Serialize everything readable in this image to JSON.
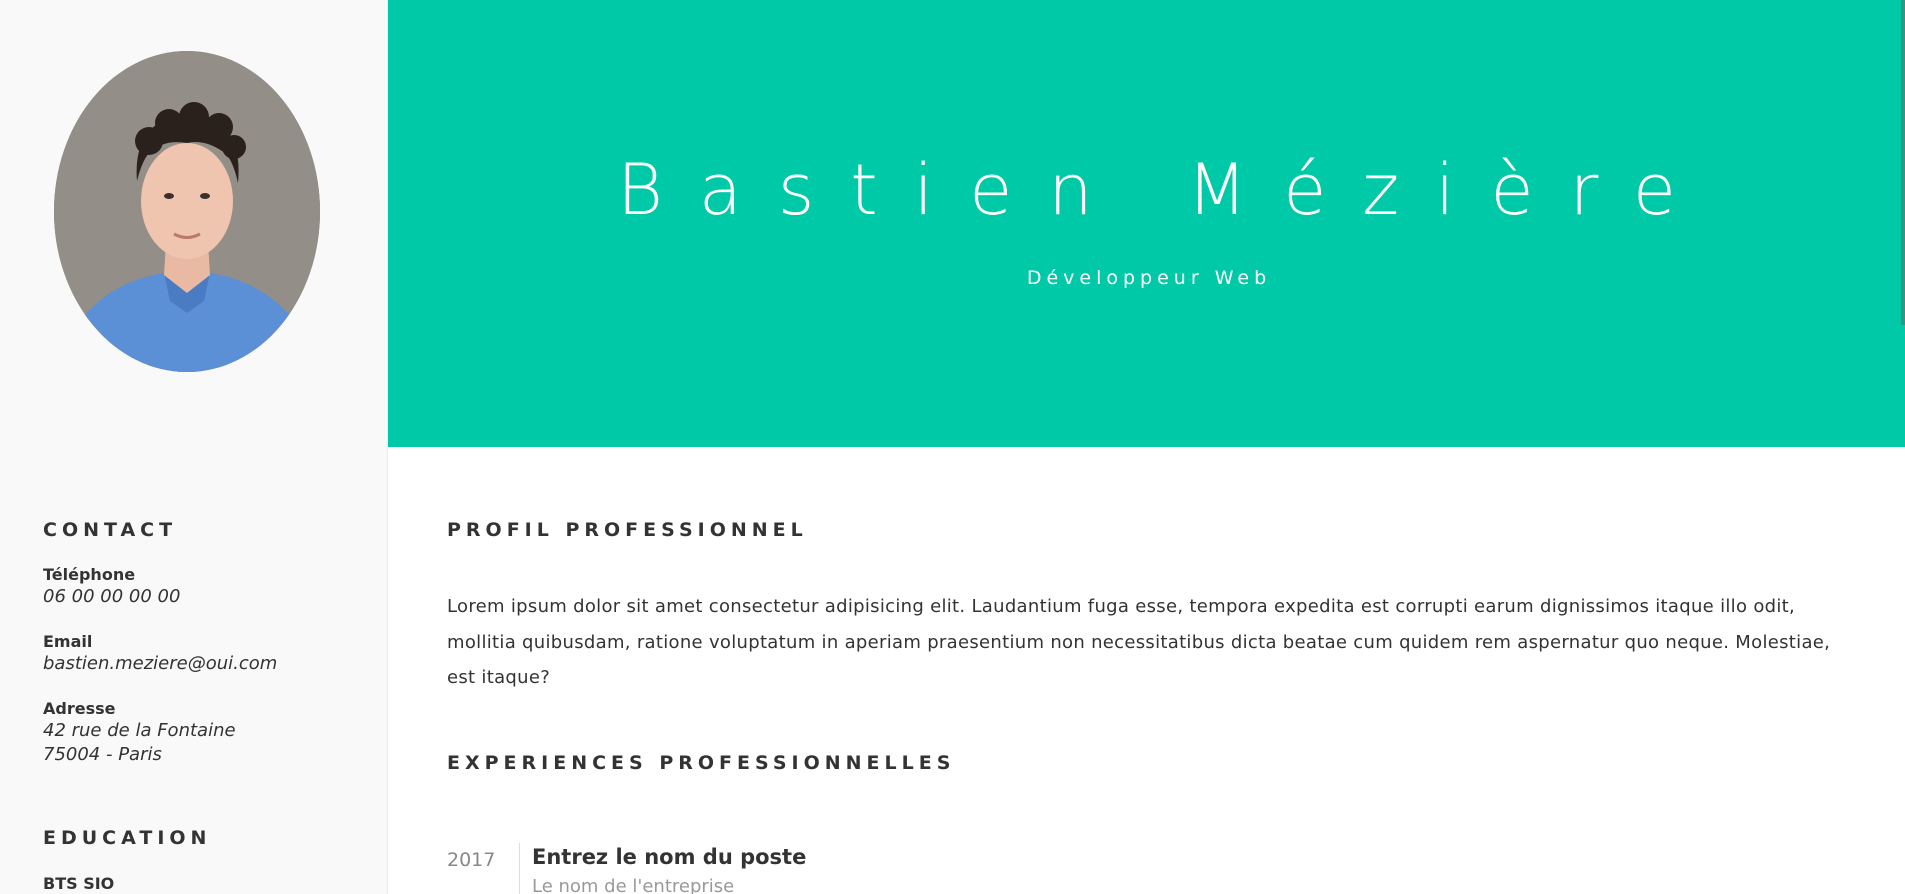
{
  "sidebar": {
    "contact_title": "CONTACT",
    "phone_label": "Téléphone",
    "phone_value": "06 00 00 00 00",
    "email_label": "Email",
    "email_value": "bastien.meziere@oui.com",
    "address_label": "Adresse",
    "address_line1": "42 rue de la Fontaine",
    "address_line2": "75004 - Paris",
    "education_title": "EDUCATION",
    "education_first": "BTS SIO"
  },
  "header": {
    "name": "Bastien Mézière",
    "role": "Développeur Web"
  },
  "main": {
    "profile_title": "PROFIL PROFESSIONNEL",
    "profile_text": "Lorem ipsum dolor sit amet consectetur adipisicing elit. Laudantium fuga esse, tempora expedita est corrupti earum dignissimos itaque illo odit, mollitia quibusdam, ratione voluptatum in aperiam praesentium non necessitatibus dicta beatae cum quidem rem aspernatur quo neque. Molestiae, est itaque?",
    "experience_title": "EXPERIENCES PROFESSIONNELLES",
    "experiences": [
      {
        "year": "2017",
        "role": "Entrez le nom du poste",
        "company": "Le nom de l'entreprise"
      }
    ]
  },
  "colors": {
    "accent": "#00c9a7",
    "sidebar_bg": "#f9f9f9",
    "text": "#333333",
    "muted": "#999999"
  }
}
